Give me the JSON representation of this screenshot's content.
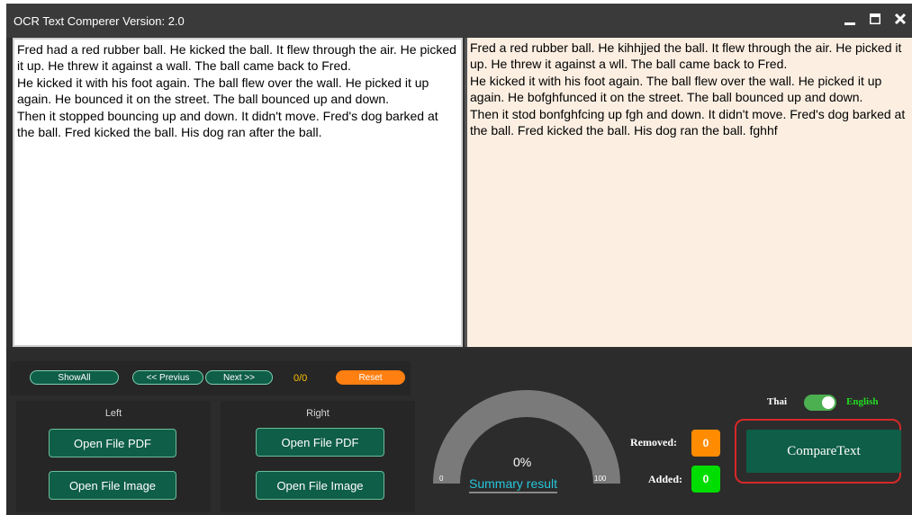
{
  "window": {
    "title": "OCR Text Comperer Version: 2.0"
  },
  "left_text": "Fred had a red rubber ball. He kicked the ball. It flew through the air. He picked it up. He threw it against a wall. The ball came back to Fred.\nHe kicked it with his foot again. The ball flew over the wall. He picked it up again. He bounced it on the street. The ball bounced up and down.\nThen it stopped bouncing up and down. It didn't move. Fred's dog barked at the ball. Fred kicked the ball. His dog ran after the ball.",
  "right_text": "Fred a red rubber ball. He kihhjjed the ball. It flew through the air. He picked it up. He threw it against a wll. The ball came back to Fred.\nHe kicked it with his foot again. The ball flew over the wall. He picked it up again. He bofghfunced it on the street. The ball bounced up and down.\nThen it stod bonfghfcing up fgh and down. It didn't move. Fred's dog barked at the ball. Fred kicked the ball. His dog ran the ball. fghhf",
  "nav": {
    "show_all": "ShowAll",
    "previous": "<< Previus",
    "next": "Next >>",
    "counter": "0/0",
    "reset": "Reset"
  },
  "left_panel": {
    "label": "Left",
    "open_pdf": "Open File PDF",
    "open_image": "Open File Image"
  },
  "right_panel": {
    "label": "Right",
    "open_pdf": "Open File PDF",
    "open_image": "Open File Image"
  },
  "gauge": {
    "percent_text": "0%",
    "label": "Summary result",
    "min": "0",
    "max": "100",
    "value": 0
  },
  "language": {
    "left": "Thai",
    "right": "English",
    "selected": "English"
  },
  "stats": {
    "removed_label": "Removed:",
    "removed_value": "0",
    "added_label": "Added:",
    "added_value": "0"
  },
  "compare_button": "CompareText",
  "colors": {
    "accent_green": "#0f5e47",
    "reset_orange": "#ff7f11",
    "removed_orange": "#ff8c00",
    "added_green": "#00dd00",
    "english_green": "#22dd22",
    "gauge_cyan": "#26c6da"
  }
}
